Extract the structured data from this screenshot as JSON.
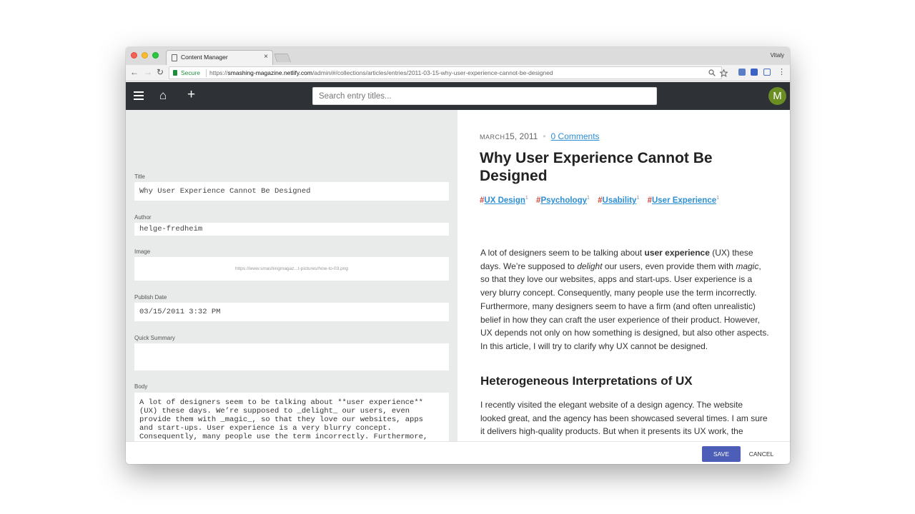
{
  "browser": {
    "tab_title": "Content Manager",
    "tab_close": "×",
    "profile": "Vitaly",
    "secure_label": "Secure",
    "url_scheme": "https://",
    "url_host": "smashing-magazine.netlify.com",
    "url_path": "/admin/#/collections/articles/entries/2011-03-15-why-user-experience-cannot-be-designed",
    "back": "←",
    "forward": "→",
    "reload": "↻"
  },
  "header": {
    "search_placeholder": "Search entry titles...",
    "avatar_letter": "M"
  },
  "editor": {
    "title_label": "Title",
    "title_value": "Why User Experience Cannot Be Designed",
    "author_label": "Author",
    "author_value": "helge-fredheim",
    "image_label": "Image",
    "image_value": "https://www.smashingmagaz...t-pictures/how-to-03.png",
    "date_label": "Publish Date",
    "date_value": "03/15/2011 3:32 PM",
    "summary_label": "Quick Summary",
    "summary_value": "",
    "body_label": "Body",
    "body_value": "A lot of designers seem to be talking about **user experience**\n(UX) these days. We’re supposed to _delight_ our users, even\nprovide them with _magic_, so that they love our websites, apps\nand start-ups. User experience is a very blurry concept.\nConsequently, many people use the term incorrectly. Furthermore,\nmany designers seem to have a firm (and often unrealistic) belief\nin how they can craft the user experience of their product.\nHowever, UX depends not only on how something is designed, but\nalso other aspects. In this article, I will try to clarify why UX\ncannot be designed."
  },
  "preview": {
    "month": "March",
    "date": "15, 2011",
    "comments": "0 Comments",
    "title": "Why User Experience Cannot Be Designed",
    "tags": [
      {
        "hash": "#",
        "name": "UX Design",
        "count": "1"
      },
      {
        "hash": "#",
        "name": "Psychology",
        "count": "1"
      },
      {
        "hash": "#",
        "name": "Usability",
        "count": "1"
      },
      {
        "hash": "#",
        "name": "User Experience",
        "count": "1"
      }
    ],
    "p1_a": "A lot of designers seem to be talking about ",
    "p1_strong": "user experience",
    "p1_b": " (UX) these days. We’re supposed to ",
    "p1_em1": "delight",
    "p1_c": " our users, even provide them with ",
    "p1_em2": "magic",
    "p1_d": ", so that they love our websites, apps and start-ups. User experience is a very blurry concept. Consequently, many people use the term incorrectly. Furthermore, many designers seem to have a firm (and often unrealistic) belief in how they can craft the user experience of their product. However, UX depends not only on how something is designed, but also other aspects. In this article, I will try to clarify why UX cannot be designed.",
    "heading2": "Heterogeneous Interpretations of UX",
    "p2": "I recently visited the elegant website of a design agency. The website looked great, and the agency has been showcased several times. I am sure it delivers high-quality products. But when it presents its UX work, the agency"
  },
  "footer": {
    "save": "SAVE",
    "cancel": "CANCEL"
  },
  "colors": {
    "app_header": "#2e3236",
    "save_button": "#4c5eb8",
    "link": "#2d8fd4",
    "tag_hash": "#d8453a",
    "avatar": "#6b8e23"
  }
}
